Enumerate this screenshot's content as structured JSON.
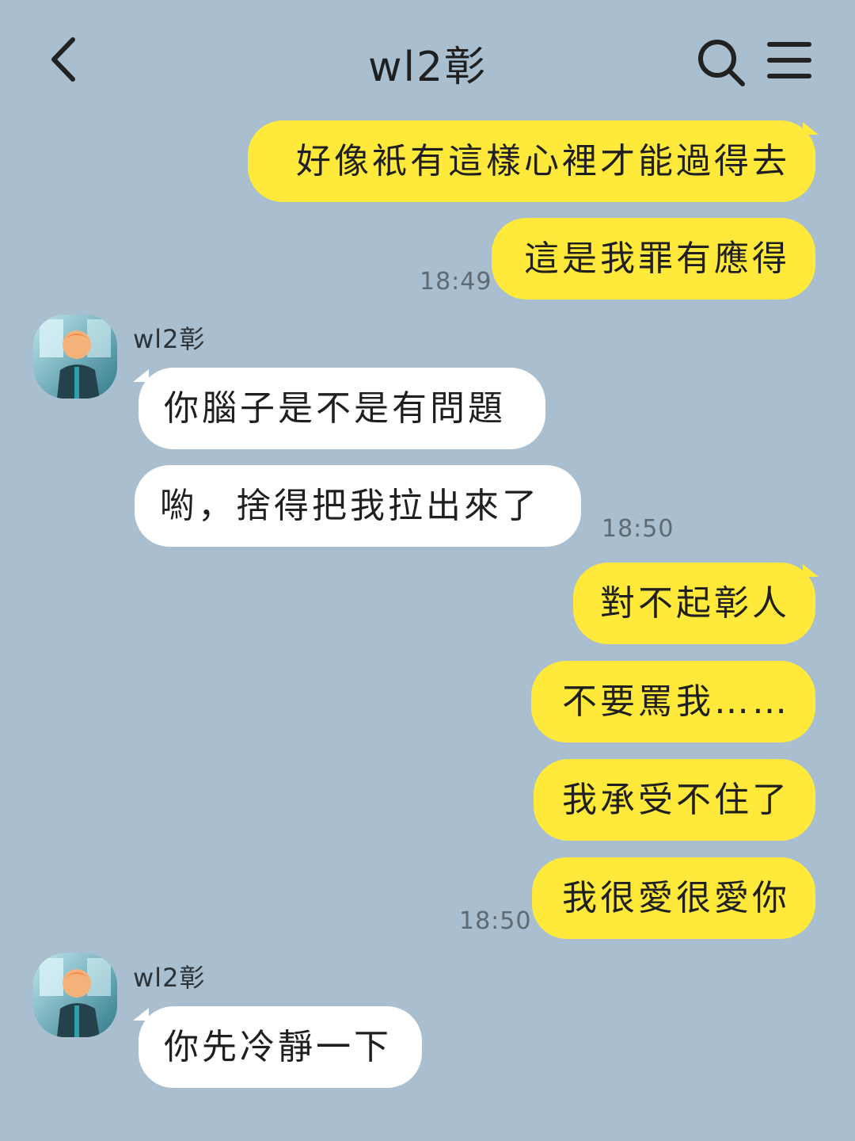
{
  "header": {
    "title": "wl2彰",
    "back_icon": "chevron-left-icon",
    "search_icon": "search-icon",
    "menu_icon": "hamburger-menu-icon"
  },
  "colors": {
    "background": "#a9bfcf",
    "outgoing_bubble": "#ffe93a",
    "incoming_bubble": "#ffffff"
  },
  "messages": [
    {
      "dir": "out",
      "text": "好像衹有這樣心裡才能過得去"
    },
    {
      "dir": "out",
      "text": "這是我罪有應得",
      "time": "18:49"
    },
    {
      "dir": "in",
      "sender": "wl2彰",
      "text": "你腦子是不是有問題"
    },
    {
      "dir": "in",
      "text": "喲，捨得把我拉出來了",
      "time": "18:50"
    },
    {
      "dir": "out",
      "text": "對不起彰人"
    },
    {
      "dir": "out",
      "text": "不要罵我……"
    },
    {
      "dir": "out",
      "text": "我承受不住了"
    },
    {
      "dir": "out",
      "text": "我很愛很愛你",
      "time": "18:50"
    },
    {
      "dir": "in",
      "sender": "wl2彰",
      "text": "你先冷靜一下"
    }
  ]
}
